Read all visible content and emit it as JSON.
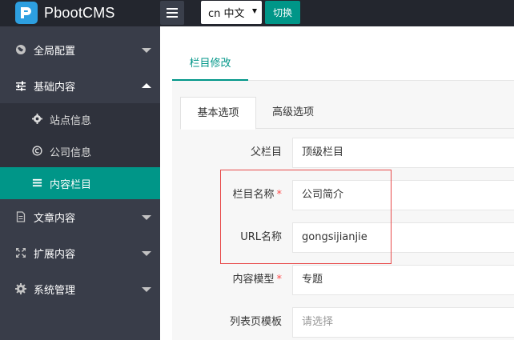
{
  "header": {
    "brand": "PbootCMS",
    "language": "cn 中文",
    "switch_label": "切换"
  },
  "sidebar": {
    "items": [
      {
        "label": "全局配置",
        "icon": "globe-icon"
      },
      {
        "label": "基础内容",
        "icon": "sliders-icon"
      },
      {
        "label": "文章内容",
        "icon": "file-icon"
      },
      {
        "label": "扩展内容",
        "icon": "expand-icon"
      },
      {
        "label": "系统管理",
        "icon": "gear-icon"
      }
    ],
    "sub_items": [
      {
        "label": "站点信息",
        "icon": "gear-icon"
      },
      {
        "label": "公司信息",
        "icon": "copyright-icon"
      },
      {
        "label": "内容栏目",
        "icon": "list-icon"
      }
    ]
  },
  "main": {
    "tab_title": "栏目修改",
    "inner_tabs": [
      "基本选项",
      "高级选项"
    ],
    "form": {
      "parent": {
        "label": "父栏目",
        "value": "顶级栏目"
      },
      "name": {
        "label": "栏目名称",
        "value": "公司简介",
        "required": "*"
      },
      "url_name": {
        "label": "URL名称",
        "value": "gongsijianjie"
      },
      "model": {
        "label": "内容模型",
        "value": "专题",
        "required": "*"
      },
      "list_template": {
        "label": "列表页模板",
        "placeholder": "请选择"
      }
    }
  },
  "colors": {
    "accent": "#009688",
    "sidebar_bg": "#393d49",
    "topbar_bg": "#23262e",
    "highlight": "#e84a4a"
  }
}
